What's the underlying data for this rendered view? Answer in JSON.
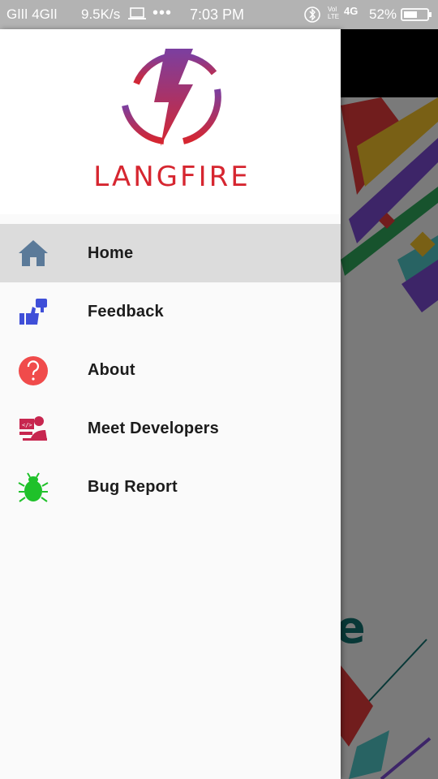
{
  "status_bar": {
    "signal": "Gǀǀǀ 4Gǀǀ ",
    "speed": "9.5K/s",
    "time": "7:03 PM",
    "volte": "Vol\nLTE",
    "network": "4G",
    "battery_percent": "52%"
  },
  "drawer": {
    "logo_text": "LANGFIRE",
    "items": [
      {
        "label": "Home",
        "icon": "home-icon",
        "active": true
      },
      {
        "label": "Feedback",
        "icon": "feedback-icon",
        "active": false
      },
      {
        "label": "About",
        "icon": "question-icon",
        "active": false
      },
      {
        "label": "Meet Developers",
        "icon": "developer-icon",
        "active": false
      },
      {
        "label": "Bug Report",
        "icon": "bug-icon",
        "active": false
      }
    ]
  },
  "background": {
    "partial_text": "e"
  },
  "colors": {
    "brand_red": "#d62630",
    "brand_purple": "#7b3fa0",
    "home_icon": "#5b7a99",
    "feedback_icon": "#3f4fd8",
    "about_icon": "#f04b4b",
    "developer_icon": "#c7264f",
    "bug_icon": "#1fc12a"
  }
}
